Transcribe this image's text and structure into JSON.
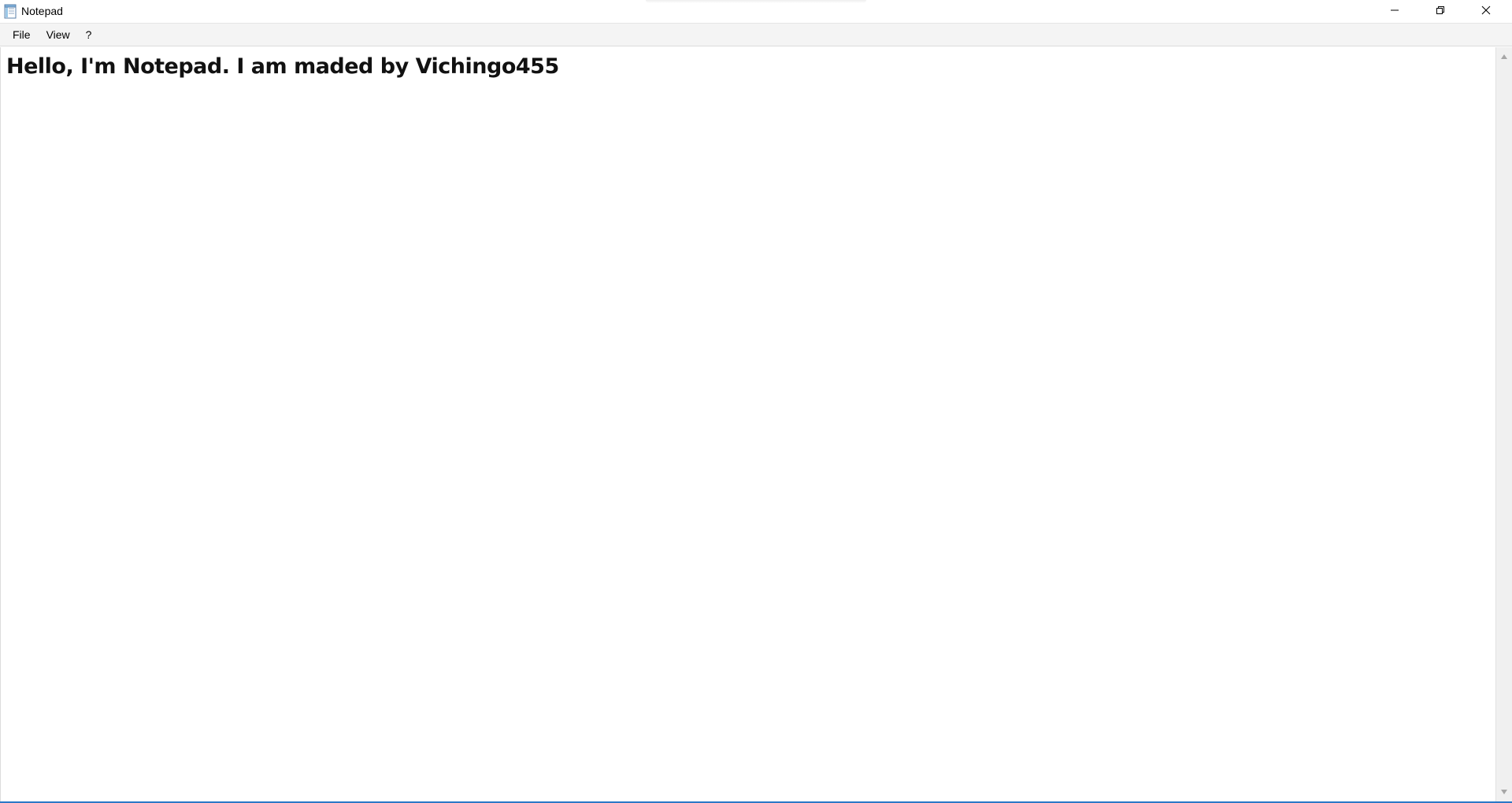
{
  "window": {
    "title": "Notepad",
    "app_icon": "notepad-icon",
    "controls": {
      "minimize_icon": "minimize-icon",
      "restore_icon": "restore-icon",
      "close_icon": "close-icon"
    }
  },
  "menubar": {
    "items": [
      {
        "label": "File"
      },
      {
        "label": "View"
      },
      {
        "label": "?"
      }
    ]
  },
  "editor": {
    "content": "Hello, I'm Notepad. I am maded by Vichingo455"
  },
  "scrollbar": {
    "up_icon": "scroll-up-arrow-icon",
    "down_icon": "scroll-down-arrow-icon"
  },
  "colors": {
    "window_bottom_border": "#2b78c6",
    "menubar_bg": "#f4f4f4",
    "scrollbar_bg": "#f0f0f0"
  }
}
